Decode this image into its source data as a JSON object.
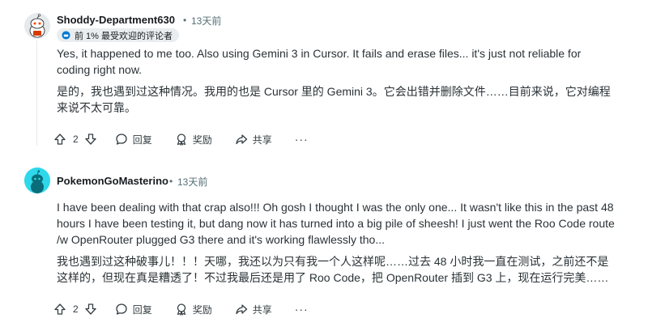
{
  "comments": [
    {
      "author": "Shoddy-Department630",
      "separator": "•",
      "time": "13天前",
      "flair": "前 1% 最受欢迎的评论者",
      "text_en": "Yes, it happened to me too. Also using Gemini 3 in Cursor. It fails and erase files... it's just not reliable for coding right now.",
      "text_zh": "是的，我也遇到过这种情况。我用的也是 Cursor 里的 Gemini 3。它会出错并删除文件……目前来说，它对编程来说不太可靠。",
      "votes": "2",
      "reply_label": "回复",
      "award_label": "奖励",
      "share_label": "共享",
      "more_label": "···",
      "avatar_icon": "snoo-avatar-icon"
    },
    {
      "author": "PokemonGoMasterino",
      "separator": "•",
      "time": "13天前",
      "text_en": "I have been dealing with that crap also!!! Oh gosh I thought I was the only one... It wasn't like this in the past 48 hours I have been testing it, but dang now it has turned into a big pile of sheesh! I just went the Roo Code route /w OpenRouter plugged G3 there and it's working flawlessly tho...",
      "text_zh": "我也遇到过这种破事儿！！！天哪，我还以为只有我一个人这样呢……过去 48 小时我一直在测试，之前还不是这样的，但现在真是糟透了！不过我最后还是用了 Roo Code，把 OpenRouter 插到 G3 上，现在运行完美……",
      "votes": "2",
      "reply_label": "回复",
      "award_label": "奖励",
      "share_label": "共享",
      "more_label": "···",
      "avatar_icon": "snoo-avatar-icon"
    }
  ],
  "colors": {
    "text": "#181c1f",
    "meta": "#576f76",
    "flair_bg": "#eaedef",
    "avatar2_bg": "#2ed8ea"
  }
}
